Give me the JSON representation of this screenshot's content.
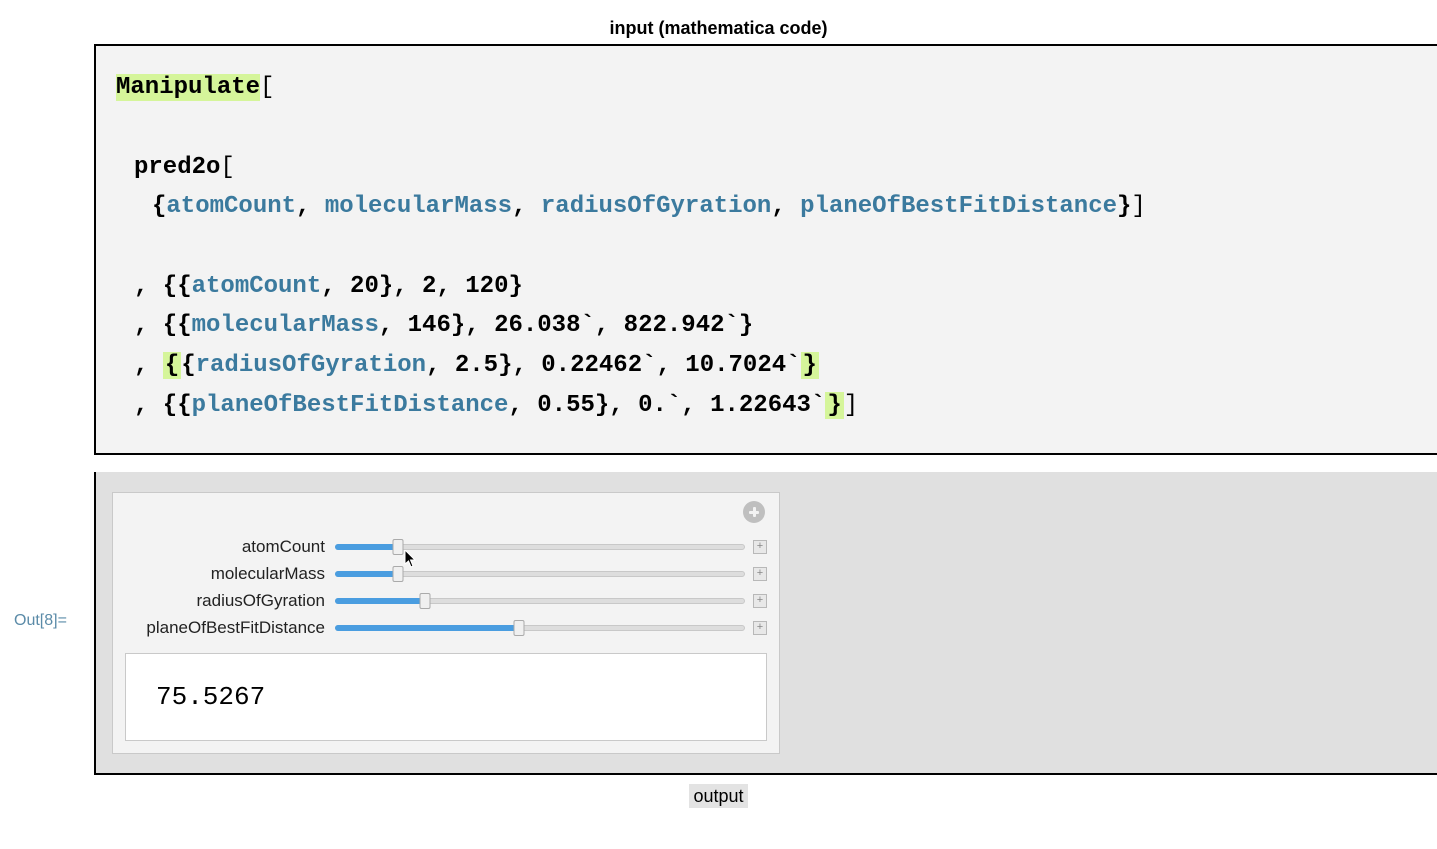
{
  "header": {
    "title": "input (mathematica code)"
  },
  "code": {
    "manipulate": "Manipulate",
    "open_bracket": "[",
    "pred_fn": "pred2o",
    "args": {
      "a1": "atomCount",
      "a2": "molecularMass",
      "a3": "radiusOfGyration",
      "a4": "planeOfBestFitDistance"
    },
    "param_lines": {
      "l1_prefix": ", {{",
      "l1_sym": "atomCount",
      "l1_rest": ", 20}, 2, 120}",
      "l2_prefix": ", {{",
      "l2_sym": "molecularMass",
      "l2_rest": ", 146}, 26.038`, 822.942`}",
      "l3_prefix": ", ",
      "l3_brace_hl": "{",
      "l3_open2": "{",
      "l3_sym": "radiusOfGyration",
      "l3_mid": ", 2.5}, 0.22462`, 10.7024`",
      "l3_close_hl": "}",
      "l4_prefix": ", {{",
      "l4_sym": "planeOfBestFitDistance",
      "l4_mid": ", 0.55}, 0.`, 1.22643`",
      "l4_close_hl": "}",
      "l4_final": "]"
    }
  },
  "out_label": "Out[8]=",
  "manipulate_panel": {
    "sliders": [
      {
        "label": "atomCount",
        "fill_pct": 15.3,
        "min": 2,
        "max": 120,
        "value": 20
      },
      {
        "label": "molecularMass",
        "fill_pct": 15.1,
        "min": 26.038,
        "max": 822.942,
        "value": 146
      },
      {
        "label": "radiusOfGyration",
        "fill_pct": 21.7,
        "min": 0.22462,
        "max": 10.7024,
        "value": 2.5
      },
      {
        "label": "planeOfBestFitDistance",
        "fill_pct": 44.8,
        "min": 0,
        "max": 1.22643,
        "value": 0.55
      }
    ],
    "result": "75.5267"
  },
  "footer": {
    "label": "output"
  }
}
